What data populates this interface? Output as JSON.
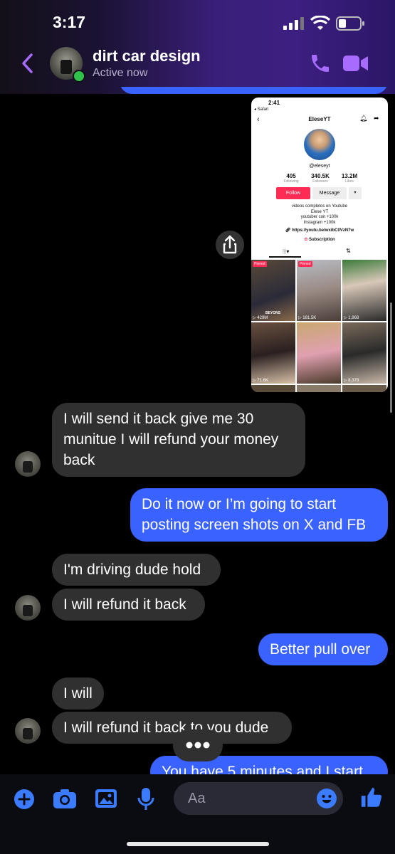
{
  "status_bar": {
    "time": "3:17"
  },
  "header": {
    "title": "dirt car design",
    "subtitle": "Active now"
  },
  "embedded_screenshot": {
    "time": "2:41",
    "back_app": "◂ Safari",
    "username_title": "EleseYT",
    "handle": "@eleseyt",
    "stats": [
      {
        "value": "405",
        "label": "Following"
      },
      {
        "value": "340.5K",
        "label": "Followers"
      },
      {
        "value": "13.2M",
        "label": "Likes"
      }
    ],
    "follow_label": "Follow",
    "message_label": "Message",
    "bio": [
      "videos completos en Youtube",
      "Elese YT",
      "youtuber con +100k",
      "Instagram +100k"
    ],
    "link": "https://youtu.be/wxibC0VzN7w",
    "subscription_label": "Subscription",
    "pinned_label": "Pinned",
    "video_counts": [
      "429M",
      "181.5K",
      "1,968",
      "71.6K",
      "",
      "8,379"
    ],
    "video_caption": "BEYONS"
  },
  "messages": [
    {
      "from": "them",
      "text_lines": [
        "I will send it back give me 30",
        "munitue I will refund your money",
        "back"
      ]
    },
    {
      "from": "me",
      "text_lines": [
        "Do it now or I’m going to start",
        "posting screen shots on X and FB"
      ]
    },
    {
      "from": "them",
      "text_lines": [
        "I'm driving dude hold"
      ]
    },
    {
      "from": "them",
      "text_lines": [
        "I will refund it back"
      ]
    },
    {
      "from": "me",
      "text_lines": [
        "Better pull over"
      ]
    },
    {
      "from": "them",
      "text_lines": [
        "I will"
      ]
    },
    {
      "from": "them",
      "text_lines": [
        "I will refund it back to you dude"
      ]
    },
    {
      "from": "me",
      "text_lines": [
        "You have 5 minutes and I start"
      ]
    }
  ],
  "composer": {
    "placeholder": "Aa"
  },
  "colors": {
    "accent": "#a86bff",
    "outgoing": "#3a62ff",
    "incoming": "#303030",
    "online": "#31c24d"
  }
}
